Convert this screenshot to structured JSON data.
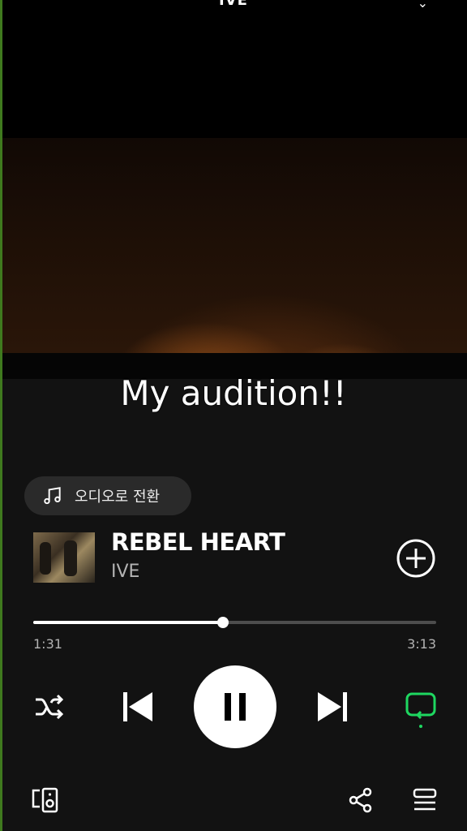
{
  "header": {
    "title": "IVE"
  },
  "video": {
    "caption": "My audition!!"
  },
  "audio_switch": {
    "label": "오디오로 전환",
    "icon": "music-note-icon"
  },
  "track": {
    "title": "REBEL HEART",
    "artist": "IVE"
  },
  "playback": {
    "elapsed": "1:31",
    "duration": "3:13",
    "progress_percent": 47
  },
  "controls": {
    "shuffle_icon": "shuffle-icon",
    "previous_icon": "skip-previous-icon",
    "play_state_icon": "pause-icon",
    "next_icon": "skip-next-icon",
    "repeat_icon": "repeat-icon",
    "repeat_active_color": "#1ed760"
  },
  "footer": {
    "devices_icon": "connect-device-icon",
    "share_icon": "share-icon",
    "queue_icon": "queue-icon"
  },
  "colors": {
    "accent": "#1ed760",
    "background": "#121212"
  }
}
